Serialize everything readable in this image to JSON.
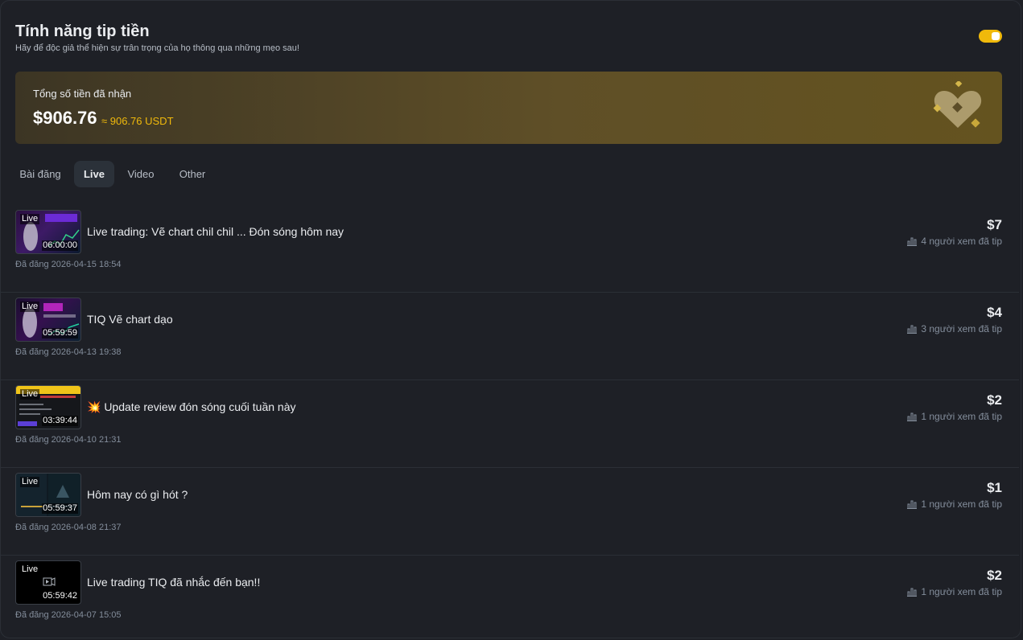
{
  "header": {
    "title": "Tính năng tip tiền",
    "subtitle": "Hãy để độc giả thể hiện sự trân trọng của họ thông qua những mẹo sau!"
  },
  "toggle": {
    "enabled": true
  },
  "summary": {
    "label": "Tổng số tiền đã nhận",
    "amount": "$906.76",
    "usdt": "≈ 906.76 USDT",
    "icon": "heart-coins-icon"
  },
  "tabs": [
    {
      "label": "Bài đăng",
      "active": false
    },
    {
      "label": "Live",
      "active": true
    },
    {
      "label": "Video",
      "active": false
    },
    {
      "label": "Other",
      "active": false
    }
  ],
  "items": [
    {
      "badge": "Live",
      "duration": "06:00:00",
      "title": "Live trading: Vẽ chart chil chil ... Đón sóng hôm nay",
      "date": "Đã đăng 2026-04-15 18:54",
      "amount": "$7",
      "viewers": "4 người xem đã tip"
    },
    {
      "badge": "Live",
      "duration": "05:59:59",
      "title": "TIQ Vẽ chart dạo",
      "date": "Đã đăng 2026-04-13 19:38",
      "amount": "$4",
      "viewers": "3 người xem đã tip"
    },
    {
      "badge": "Live",
      "duration": "03:39:44",
      "title": "💥 Update review đón sóng cuối tuần này",
      "date": "Đã đăng 2026-04-10 21:31",
      "amount": "$2",
      "viewers": "1 người xem đã tip"
    },
    {
      "badge": "Live",
      "duration": "05:59:37",
      "title": "Hôm nay có gì hót ?",
      "date": "Đã đăng 2026-04-08 21:37",
      "amount": "$1",
      "viewers": "1 người xem đã tip"
    },
    {
      "badge": "Live",
      "duration": "05:59:42",
      "title": "Live trading TIQ đã nhắc đến bạn!!",
      "date": "Đã đăng 2026-04-07 15:05",
      "amount": "$2",
      "viewers": "1 người xem đã tip"
    }
  ],
  "colors": {
    "accent": "#f0b90b",
    "background": "#1e2026",
    "muted": "#848e9c"
  }
}
